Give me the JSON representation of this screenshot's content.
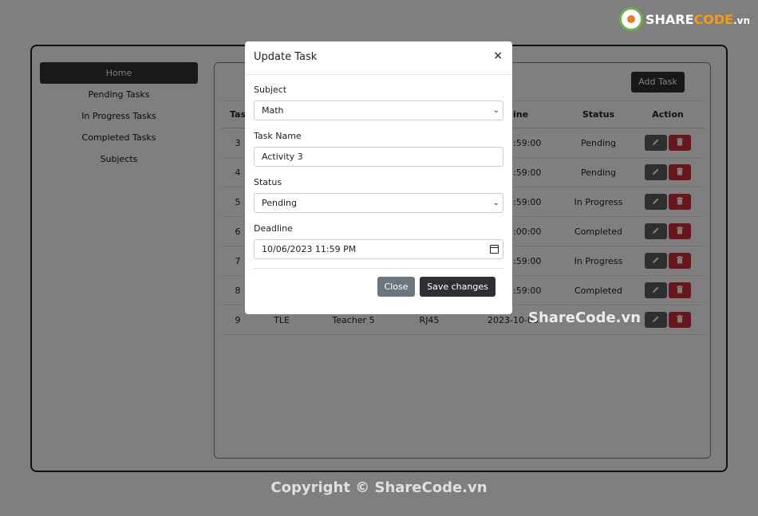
{
  "sidebar": {
    "items": [
      {
        "label": "Home"
      },
      {
        "label": "Pending Tasks"
      },
      {
        "label": "In Progress Tasks"
      },
      {
        "label": "Completed Tasks"
      },
      {
        "label": "Subjects"
      }
    ]
  },
  "toolbar": {
    "add_task_label": "Add Task"
  },
  "table": {
    "headers": {
      "task": "Tas",
      "deadline": "adline",
      "status": "Status",
      "action": "Action"
    },
    "rows": [
      {
        "task": "3",
        "deadline": "-06 23:59:00",
        "status": "Pending"
      },
      {
        "task": "4",
        "deadline": "-13 23:59:00",
        "status": "Pending"
      },
      {
        "task": "5",
        "deadline": "-20 23:59:00",
        "status": "In Progress"
      },
      {
        "task": "6",
        "deadline": "-02 12:00:00",
        "status": "Completed"
      },
      {
        "task": "7",
        "deadline": "-06 23:59:00",
        "status": "In Progress"
      },
      {
        "task": "8",
        "deadline": "-02 23:59:00",
        "status": "Completed"
      },
      {
        "task": "9",
        "subject": "TLE",
        "teacher": "Teacher 5",
        "name": "RJ45",
        "deadline": "2023-10-03",
        "status": ""
      }
    ]
  },
  "modal": {
    "title": "Update Task",
    "close_symbol": "×",
    "subject_label": "Subject",
    "subject_value": "Math",
    "task_name_label": "Task Name",
    "task_name_value": "Activity 3",
    "status_label": "Status",
    "status_value": "Pending",
    "deadline_label": "Deadline",
    "deadline_value": "10/06/2023 11:59 PM",
    "close_button": "Close",
    "save_button": "Save changes"
  },
  "branding": {
    "logo_share": "SHARE",
    "logo_code": "CODE",
    "logo_tld": ".vn",
    "watermark": "ShareCode.vn",
    "copyright": "Copyright © ShareCode.vn"
  },
  "colors": {
    "primary_dark": "#2d2f33",
    "danger": "#d32f3a",
    "secondary": "#6c757d",
    "backdrop": "rgba(0,0,0,0.5)"
  }
}
